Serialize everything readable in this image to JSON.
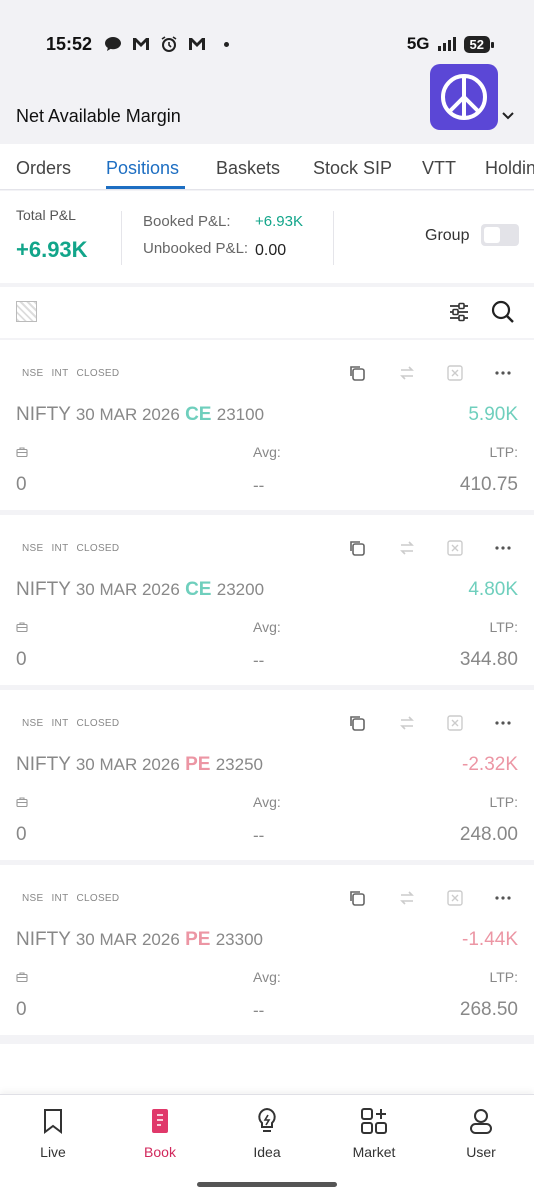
{
  "status": {
    "time": "15:52",
    "network": "5G",
    "battery": "52"
  },
  "header": {
    "title": "Net Available Margin"
  },
  "tabs": [
    {
      "label": "Orders",
      "active": false
    },
    {
      "label": "Positions",
      "active": true
    },
    {
      "label": "Baskets",
      "active": false
    },
    {
      "label": "Stock SIP",
      "active": false
    },
    {
      "label": "VTT",
      "active": false
    },
    {
      "label": "Holdings",
      "active": false
    }
  ],
  "summary": {
    "total_label": "Total P&L",
    "total_value": "+6.93K",
    "booked_label": "Booked P&L:",
    "booked_value": "+6.93K",
    "unbooked_label": "Unbooked P&L:",
    "unbooked_value": "0.00",
    "group_label": "Group"
  },
  "positions": [
    {
      "tags": [
        "NSE",
        "INT",
        "CLOSED"
      ],
      "underlying": "NIFTY",
      "expiry": "30 MAR 2026",
      "option_type": "CE",
      "strike": "23100",
      "pnl": "5.90K",
      "qty_value": "0",
      "avg_label": "Avg:",
      "avg_value": "--",
      "ltp_label": "LTP:",
      "ltp_value": "410.75"
    },
    {
      "tags": [
        "NSE",
        "INT",
        "CLOSED"
      ],
      "underlying": "NIFTY",
      "expiry": "30 MAR 2026",
      "option_type": "CE",
      "strike": "23200",
      "pnl": "4.80K",
      "qty_value": "0",
      "avg_label": "Avg:",
      "avg_value": "--",
      "ltp_label": "LTP:",
      "ltp_value": "344.80"
    },
    {
      "tags": [
        "NSE",
        "INT",
        "CLOSED"
      ],
      "underlying": "NIFTY",
      "expiry": "30 MAR 2026",
      "option_type": "PE",
      "strike": "23250",
      "pnl": "-2.32K",
      "qty_value": "0",
      "avg_label": "Avg:",
      "avg_value": "--",
      "ltp_label": "LTP:",
      "ltp_value": "248.00"
    },
    {
      "tags": [
        "NSE",
        "INT",
        "CLOSED"
      ],
      "underlying": "NIFTY",
      "expiry": "30 MAR 2026",
      "option_type": "PE",
      "strike": "23300",
      "pnl": "-1.44K",
      "qty_value": "0",
      "avg_label": "Avg:",
      "avg_value": "--",
      "ltp_label": "LTP:",
      "ltp_value": "268.50"
    }
  ],
  "bottom_nav": [
    {
      "label": "Live",
      "icon": "bookmark-icon",
      "active": false
    },
    {
      "label": "Book",
      "icon": "book-icon",
      "active": true
    },
    {
      "label": "Idea",
      "icon": "lightbulb-icon",
      "active": false
    },
    {
      "label": "Market",
      "icon": "grid-plus-icon",
      "active": false
    },
    {
      "label": "User",
      "icon": "user-icon",
      "active": false
    }
  ],
  "colors": {
    "accent_blue": "#1d6ec2",
    "profit_green": "#12a58a",
    "loss_pink": "#ec96a4",
    "nav_active": "#d1285c",
    "avatar_bg": "#5b47d6"
  }
}
